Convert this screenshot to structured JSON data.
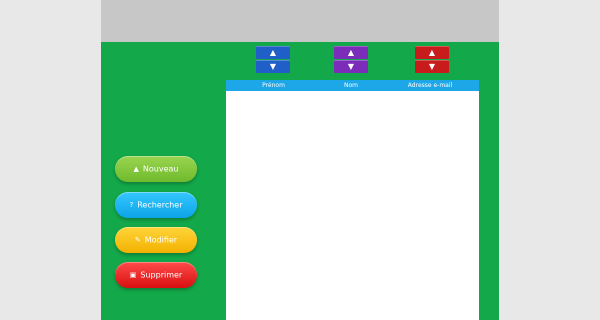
{
  "sort_controls": {
    "prenom": {
      "up": "▲",
      "down": "▼"
    },
    "nom": {
      "up": "▲",
      "down": "▼"
    },
    "email": {
      "up": "▲",
      "down": "▼"
    }
  },
  "list": {
    "headers": [
      "Prénom",
      "Nom",
      "Adresse e-mail"
    ],
    "rows": []
  },
  "actions": {
    "nouveau": {
      "label": "Nouveau",
      "icon": "▲"
    },
    "rechercher": {
      "label": "Rechercher",
      "icon": "?"
    },
    "modifier": {
      "label": "Modifier",
      "icon": "✎"
    },
    "supprimer": {
      "label": "Supprimer",
      "icon": "▣"
    }
  },
  "colors": {
    "background": "#13a84a",
    "header": "#1ea7e8",
    "panel": "#ffffff",
    "topbar": "#c7c7c7"
  }
}
